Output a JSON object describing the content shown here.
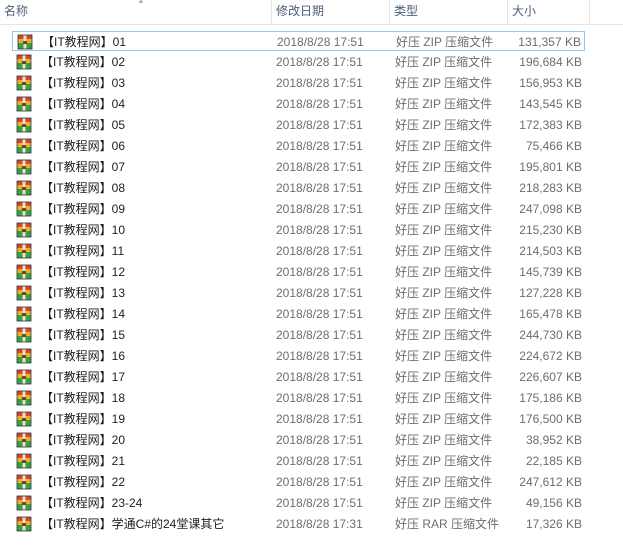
{
  "columns": {
    "name": "名称",
    "date": "修改日期",
    "type": "类型",
    "size": "大小"
  },
  "file_icon": "archive-icon",
  "files": [
    {
      "name": "【IT教程网】01",
      "date": "2018/8/28 17:51",
      "type": "好压 ZIP 压缩文件",
      "size": "131,357 KB"
    },
    {
      "name": "【IT教程网】02",
      "date": "2018/8/28 17:51",
      "type": "好压 ZIP 压缩文件",
      "size": "196,684 KB"
    },
    {
      "name": "【IT教程网】03",
      "date": "2018/8/28 17:51",
      "type": "好压 ZIP 压缩文件",
      "size": "156,953 KB"
    },
    {
      "name": "【IT教程网】04",
      "date": "2018/8/28 17:51",
      "type": "好压 ZIP 压缩文件",
      "size": "143,545 KB"
    },
    {
      "name": "【IT教程网】05",
      "date": "2018/8/28 17:51",
      "type": "好压 ZIP 压缩文件",
      "size": "172,383 KB"
    },
    {
      "name": "【IT教程网】06",
      "date": "2018/8/28 17:51",
      "type": "好压 ZIP 压缩文件",
      "size": "75,466 KB"
    },
    {
      "name": "【IT教程网】07",
      "date": "2018/8/28 17:51",
      "type": "好压 ZIP 压缩文件",
      "size": "195,801 KB"
    },
    {
      "name": "【IT教程网】08",
      "date": "2018/8/28 17:51",
      "type": "好压 ZIP 压缩文件",
      "size": "218,283 KB"
    },
    {
      "name": "【IT教程网】09",
      "date": "2018/8/28 17:51",
      "type": "好压 ZIP 压缩文件",
      "size": "247,098 KB"
    },
    {
      "name": "【IT教程网】10",
      "date": "2018/8/28 17:51",
      "type": "好压 ZIP 压缩文件",
      "size": "215,230 KB"
    },
    {
      "name": "【IT教程网】11",
      "date": "2018/8/28 17:51",
      "type": "好压 ZIP 压缩文件",
      "size": "214,503 KB"
    },
    {
      "name": "【IT教程网】12",
      "date": "2018/8/28 17:51",
      "type": "好压 ZIP 压缩文件",
      "size": "145,739 KB"
    },
    {
      "name": "【IT教程网】13",
      "date": "2018/8/28 17:51",
      "type": "好压 ZIP 压缩文件",
      "size": "127,228 KB"
    },
    {
      "name": "【IT教程网】14",
      "date": "2018/8/28 17:51",
      "type": "好压 ZIP 压缩文件",
      "size": "165,478 KB"
    },
    {
      "name": "【IT教程网】15",
      "date": "2018/8/28 17:51",
      "type": "好压 ZIP 压缩文件",
      "size": "244,730 KB"
    },
    {
      "name": "【IT教程网】16",
      "date": "2018/8/28 17:51",
      "type": "好压 ZIP 压缩文件",
      "size": "224,672 KB"
    },
    {
      "name": "【IT教程网】17",
      "date": "2018/8/28 17:51",
      "type": "好压 ZIP 压缩文件",
      "size": "226,607 KB"
    },
    {
      "name": "【IT教程网】18",
      "date": "2018/8/28 17:51",
      "type": "好压 ZIP 压缩文件",
      "size": "175,186 KB"
    },
    {
      "name": "【IT教程网】19",
      "date": "2018/8/28 17:51",
      "type": "好压 ZIP 压缩文件",
      "size": "176,500 KB"
    },
    {
      "name": "【IT教程网】20",
      "date": "2018/8/28 17:51",
      "type": "好压 ZIP 压缩文件",
      "size": "38,952 KB"
    },
    {
      "name": "【IT教程网】21",
      "date": "2018/8/28 17:51",
      "type": "好压 ZIP 压缩文件",
      "size": "22,185 KB"
    },
    {
      "name": "【IT教程网】22",
      "date": "2018/8/28 17:51",
      "type": "好压 ZIP 压缩文件",
      "size": "247,612 KB"
    },
    {
      "name": "【IT教程网】23-24",
      "date": "2018/8/28 17:51",
      "type": "好压 ZIP 压缩文件",
      "size": "49,156 KB"
    },
    {
      "name": "【IT教程网】学通C#的24堂课其它",
      "date": "2018/8/28 17:31",
      "type": "好压 RAR 压缩文件",
      "size": "17,326 KB"
    }
  ]
}
